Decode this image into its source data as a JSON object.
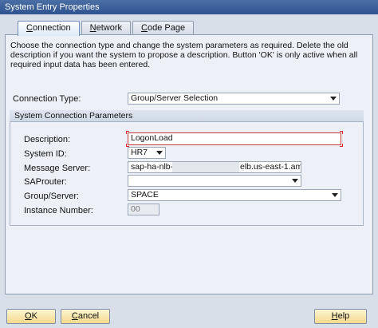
{
  "window": {
    "title": "System Entry Properties"
  },
  "tabs": [
    {
      "label": "Connection",
      "mnemonic": "C",
      "rest": "onnection",
      "active": true
    },
    {
      "label": "Network",
      "mnemonic": "N",
      "rest": "etwork",
      "active": false
    },
    {
      "label": "Code Page",
      "mnemonic": "C",
      "rest": "ode Page",
      "active": false
    }
  ],
  "connection": {
    "description_text": "Choose the connection type and change the system parameters as required. Delete the old description if you want the system to propose a description. Button 'OK' is only active when all required input data has been entered.",
    "connection_type_label": "Connection Type:",
    "connection_type_value": "Group/Server Selection",
    "group_title": "System Connection Parameters",
    "description_label": "Description:",
    "description_value": "LogonLoad",
    "system_id_label": "System ID:",
    "system_id_value": "HR7",
    "message_server_label": "Message Server:",
    "message_server_prefix": "sap-ha-nlb-",
    "message_server_suffix": "elb.us-east-1.am",
    "saprouter_label": "SAProuter:",
    "saprouter_value": "",
    "group_server_label": "Group/Server:",
    "group_server_value": "SPACE",
    "instance_number_label": "Instance Number:",
    "instance_number_value": "00"
  },
  "buttons": {
    "ok": {
      "mnemonic": "O",
      "rest": "K"
    },
    "cancel": {
      "mnemonic": "C",
      "rest": "ancel"
    },
    "help": {
      "mnemonic": "H",
      "rest": "elp"
    }
  },
  "colors": {
    "accent": "#2f5390",
    "button": "#f4d98b",
    "focus": "#d22222"
  }
}
